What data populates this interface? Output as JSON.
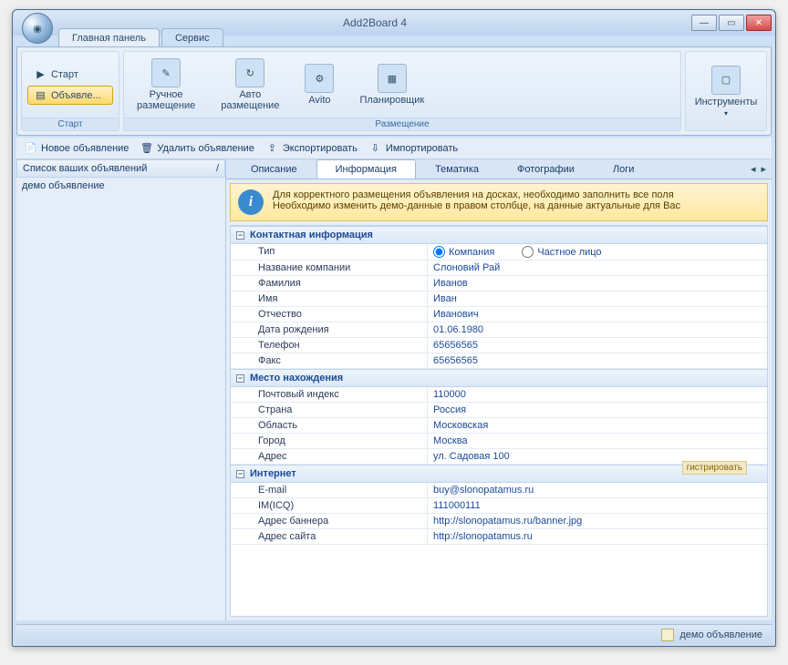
{
  "window": {
    "title": "Add2Board 4"
  },
  "tabs": {
    "main": "Главная панель",
    "service": "Сервис"
  },
  "ribbon": {
    "start_group": {
      "start": "Старт",
      "ads": "Объявле...",
      "title": "Старт"
    },
    "place_group": {
      "manual": "Ручное\nразмещение",
      "auto": "Авто\nразмещение",
      "avito": "Avito",
      "scheduler": "Планировщик",
      "title": "Размещение"
    },
    "tools": "Инструменты"
  },
  "toolbar": {
    "new_ad": "Новое объявление",
    "delete_ad": "Удалить объявление",
    "export": "Экспортировать",
    "import": "Импортировать"
  },
  "left": {
    "header": "Список ваших объявлений",
    "item0": "демо объявление"
  },
  "subtabs": {
    "description": "Описание",
    "info": "Информация",
    "topic": "Тематика",
    "photos": "Фотографии",
    "logs": "Логи"
  },
  "info_note": {
    "line1": "Для корректного размещения объявления на досках, необходимо заполнить все поля",
    "line2": "Необходимо изменить демо-данные в правом столбце, на данные актуальные для Вас"
  },
  "sections": {
    "contact": "Контактная информация",
    "location": "Место нахождения",
    "internet": "Интернет"
  },
  "fields": {
    "type": "Тип",
    "type_company": "Компания",
    "type_person": "Частное лицо",
    "company_name": "Название компании",
    "company_name_v": "Слоновий Рай",
    "lastname": "Фамилия",
    "lastname_v": "Иванов",
    "firstname": "Имя",
    "firstname_v": "Иван",
    "middlename": "Отчество",
    "middlename_v": "Иванович",
    "birthdate": "Дата рождения",
    "birthdate_v": "01.06.1980",
    "phone": "Телефон",
    "phone_v": "65656565",
    "fax": "Факс",
    "fax_v": "65656565",
    "zip": "Почтовый индекс",
    "zip_v": "110000",
    "country": "Страна",
    "country_v": "Россия",
    "region": "Область",
    "region_v": "Московская",
    "city": "Город",
    "city_v": "Москва",
    "address": "Адрес",
    "address_v": "ул. Садовая 100",
    "email": "E-mail",
    "email_v": "buy@slonopatamus.ru",
    "register": "гистрировать",
    "icq": "IM(ICQ)",
    "icq_v": "111000111",
    "banner": "Адрес баннера",
    "banner_v": "http://slonopatamus.ru/banner.jpg",
    "site": "Адрес сайта",
    "site_v": "http://slonopatamus.ru"
  },
  "status": "демо объявление"
}
